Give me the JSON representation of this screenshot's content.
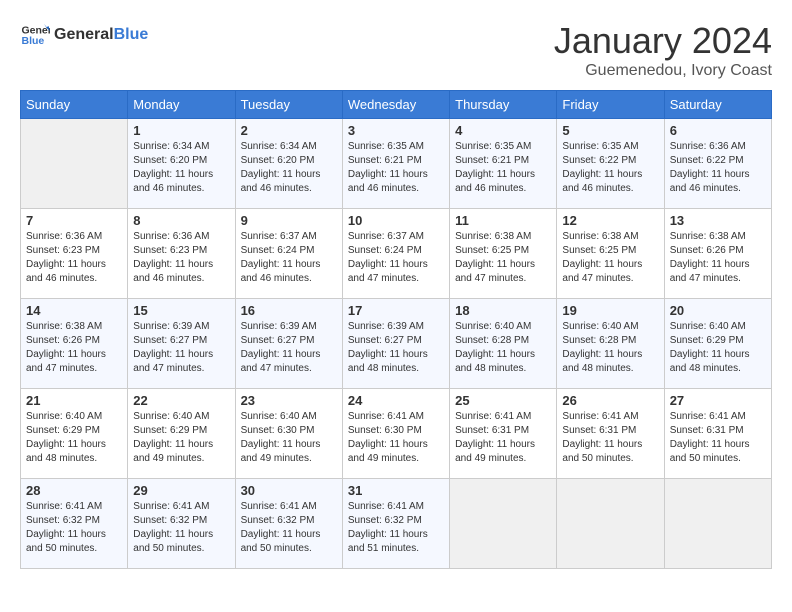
{
  "header": {
    "logo_general": "General",
    "logo_blue": "Blue",
    "title": "January 2024",
    "subtitle": "Guemenedou, Ivory Coast"
  },
  "weekdays": [
    "Sunday",
    "Monday",
    "Tuesday",
    "Wednesday",
    "Thursday",
    "Friday",
    "Saturday"
  ],
  "weeks": [
    [
      {
        "day": "",
        "info": ""
      },
      {
        "day": "1",
        "info": "Sunrise: 6:34 AM\nSunset: 6:20 PM\nDaylight: 11 hours\nand 46 minutes."
      },
      {
        "day": "2",
        "info": "Sunrise: 6:34 AM\nSunset: 6:20 PM\nDaylight: 11 hours\nand 46 minutes."
      },
      {
        "day": "3",
        "info": "Sunrise: 6:35 AM\nSunset: 6:21 PM\nDaylight: 11 hours\nand 46 minutes."
      },
      {
        "day": "4",
        "info": "Sunrise: 6:35 AM\nSunset: 6:21 PM\nDaylight: 11 hours\nand 46 minutes."
      },
      {
        "day": "5",
        "info": "Sunrise: 6:35 AM\nSunset: 6:22 PM\nDaylight: 11 hours\nand 46 minutes."
      },
      {
        "day": "6",
        "info": "Sunrise: 6:36 AM\nSunset: 6:22 PM\nDaylight: 11 hours\nand 46 minutes."
      }
    ],
    [
      {
        "day": "7",
        "info": "Sunrise: 6:36 AM\nSunset: 6:23 PM\nDaylight: 11 hours\nand 46 minutes."
      },
      {
        "day": "8",
        "info": "Sunrise: 6:36 AM\nSunset: 6:23 PM\nDaylight: 11 hours\nand 46 minutes."
      },
      {
        "day": "9",
        "info": "Sunrise: 6:37 AM\nSunset: 6:24 PM\nDaylight: 11 hours\nand 46 minutes."
      },
      {
        "day": "10",
        "info": "Sunrise: 6:37 AM\nSunset: 6:24 PM\nDaylight: 11 hours\nand 47 minutes."
      },
      {
        "day": "11",
        "info": "Sunrise: 6:38 AM\nSunset: 6:25 PM\nDaylight: 11 hours\nand 47 minutes."
      },
      {
        "day": "12",
        "info": "Sunrise: 6:38 AM\nSunset: 6:25 PM\nDaylight: 11 hours\nand 47 minutes."
      },
      {
        "day": "13",
        "info": "Sunrise: 6:38 AM\nSunset: 6:26 PM\nDaylight: 11 hours\nand 47 minutes."
      }
    ],
    [
      {
        "day": "14",
        "info": "Sunrise: 6:38 AM\nSunset: 6:26 PM\nDaylight: 11 hours\nand 47 minutes."
      },
      {
        "day": "15",
        "info": "Sunrise: 6:39 AM\nSunset: 6:27 PM\nDaylight: 11 hours\nand 47 minutes."
      },
      {
        "day": "16",
        "info": "Sunrise: 6:39 AM\nSunset: 6:27 PM\nDaylight: 11 hours\nand 47 minutes."
      },
      {
        "day": "17",
        "info": "Sunrise: 6:39 AM\nSunset: 6:27 PM\nDaylight: 11 hours\nand 48 minutes."
      },
      {
        "day": "18",
        "info": "Sunrise: 6:40 AM\nSunset: 6:28 PM\nDaylight: 11 hours\nand 48 minutes."
      },
      {
        "day": "19",
        "info": "Sunrise: 6:40 AM\nSunset: 6:28 PM\nDaylight: 11 hours\nand 48 minutes."
      },
      {
        "day": "20",
        "info": "Sunrise: 6:40 AM\nSunset: 6:29 PM\nDaylight: 11 hours\nand 48 minutes."
      }
    ],
    [
      {
        "day": "21",
        "info": "Sunrise: 6:40 AM\nSunset: 6:29 PM\nDaylight: 11 hours\nand 48 minutes."
      },
      {
        "day": "22",
        "info": "Sunrise: 6:40 AM\nSunset: 6:29 PM\nDaylight: 11 hours\nand 49 minutes."
      },
      {
        "day": "23",
        "info": "Sunrise: 6:40 AM\nSunset: 6:30 PM\nDaylight: 11 hours\nand 49 minutes."
      },
      {
        "day": "24",
        "info": "Sunrise: 6:41 AM\nSunset: 6:30 PM\nDaylight: 11 hours\nand 49 minutes."
      },
      {
        "day": "25",
        "info": "Sunrise: 6:41 AM\nSunset: 6:31 PM\nDaylight: 11 hours\nand 49 minutes."
      },
      {
        "day": "26",
        "info": "Sunrise: 6:41 AM\nSunset: 6:31 PM\nDaylight: 11 hours\nand 50 minutes."
      },
      {
        "day": "27",
        "info": "Sunrise: 6:41 AM\nSunset: 6:31 PM\nDaylight: 11 hours\nand 50 minutes."
      }
    ],
    [
      {
        "day": "28",
        "info": "Sunrise: 6:41 AM\nSunset: 6:32 PM\nDaylight: 11 hours\nand 50 minutes."
      },
      {
        "day": "29",
        "info": "Sunrise: 6:41 AM\nSunset: 6:32 PM\nDaylight: 11 hours\nand 50 minutes."
      },
      {
        "day": "30",
        "info": "Sunrise: 6:41 AM\nSunset: 6:32 PM\nDaylight: 11 hours\nand 50 minutes."
      },
      {
        "day": "31",
        "info": "Sunrise: 6:41 AM\nSunset: 6:32 PM\nDaylight: 11 hours\nand 51 minutes."
      },
      {
        "day": "",
        "info": ""
      },
      {
        "day": "",
        "info": ""
      },
      {
        "day": "",
        "info": ""
      }
    ]
  ]
}
